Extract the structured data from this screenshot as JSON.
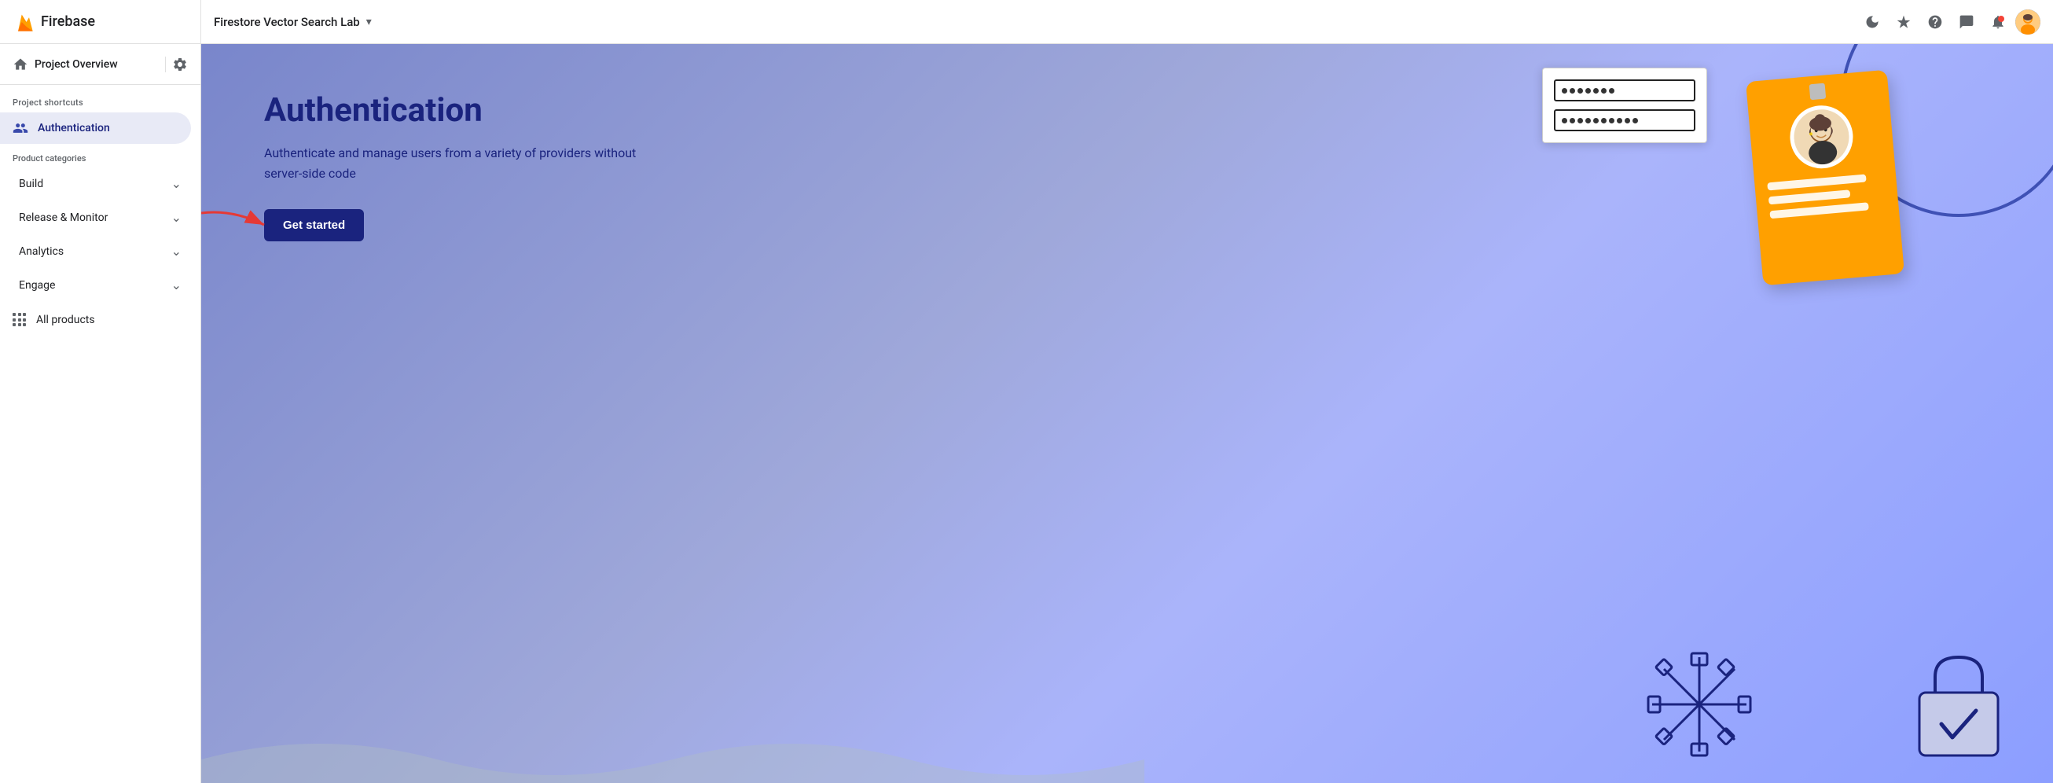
{
  "sidebar": {
    "firebase_label": "Firebase",
    "project_overview_label": "Project Overview",
    "project_shortcuts_label": "Project shortcuts",
    "authentication_label": "Authentication",
    "product_categories_label": "Product categories",
    "build_label": "Build",
    "release_monitor_label": "Release & Monitor",
    "analytics_label": "Analytics",
    "engage_label": "Engage",
    "all_products_label": "All products"
  },
  "topbar": {
    "project_name": "Firestore Vector Search Lab",
    "dropdown_symbol": "▾"
  },
  "topbar_icons": {
    "moon_icon": "🌙",
    "sparkle_icon": "✦",
    "help_icon": "?",
    "chat_icon": "💬",
    "bell_icon": "🔔"
  },
  "hero": {
    "title": "Authentication",
    "description": "Authenticate and manage users from a variety of providers without server-side code",
    "get_started_label": "Get started"
  },
  "form_illustration": {
    "row1_dots": [
      "●",
      "●",
      "●",
      "●",
      "●",
      "●",
      "●"
    ],
    "row2_dots": [
      "●",
      "●",
      "●",
      "●",
      "●",
      "●",
      "●",
      "●",
      "●",
      "●"
    ]
  }
}
